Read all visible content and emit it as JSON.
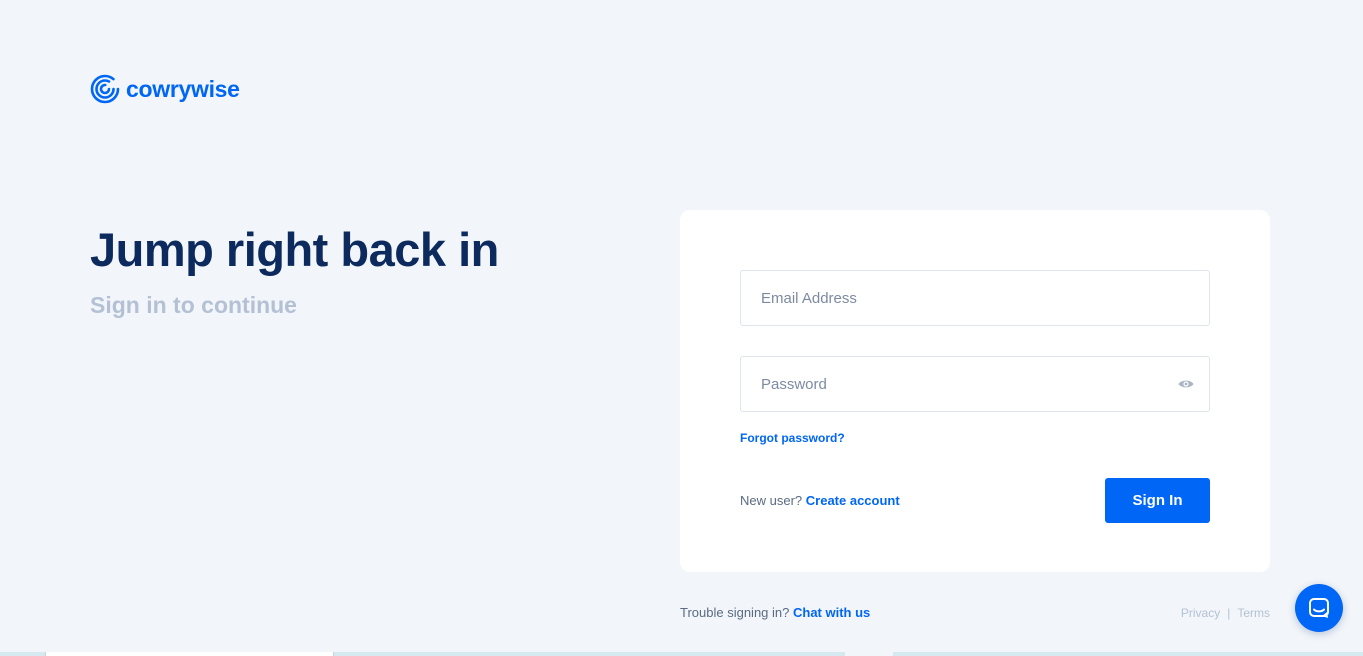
{
  "brand": {
    "name": "cowrywise",
    "logo_icon": "cowrywise-spiral-logo",
    "color": "#0066f5"
  },
  "hero": {
    "title": "Jump right back in",
    "subtitle": "Sign in to continue"
  },
  "form": {
    "email_placeholder": "Email Address",
    "password_placeholder": "Password",
    "password_toggle_icon": "eye-icon",
    "forgot_password": "Forgot password?",
    "new_user_prefix": "New user?",
    "create_account": "Create account",
    "submit_label": "Sign In"
  },
  "footer": {
    "trouble_prefix": "Trouble signing in?",
    "chat_link": "Chat with us",
    "privacy": "Privacy",
    "separator": "|",
    "terms": "Terms"
  },
  "chat_widget": {
    "icon": "chat-bubble-icon"
  },
  "colors": {
    "background": "#f2f6fa",
    "primary": "#0066f5",
    "heading": "#0c2a5e",
    "muted": "#b4c1d4"
  }
}
